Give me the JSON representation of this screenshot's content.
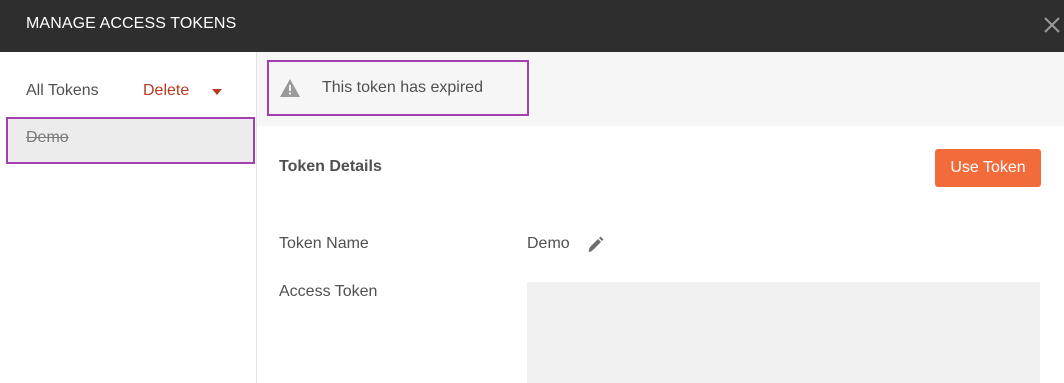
{
  "header": {
    "title": "MANAGE ACCESS TOKENS",
    "close_icon": "close-icon"
  },
  "sidebar": {
    "all_tokens_label": "All Tokens",
    "delete_label": "Delete",
    "dropdown_icon": "caret-down-icon",
    "tokens": [
      {
        "label": "Demo",
        "expired": true,
        "selected": true
      }
    ]
  },
  "detail": {
    "warning": {
      "icon": "warning-icon",
      "text": "This token has expired"
    },
    "section_title": "Token Details",
    "use_token_label": "Use Token",
    "fields": {
      "name_label": "Token Name",
      "name_value": "Demo",
      "edit_icon": "pencil-icon",
      "access_label": "Access Token",
      "access_value": ""
    }
  },
  "colors": {
    "header_bg": "#2e2e2e",
    "accent": "#f26b3a",
    "delete": "#b93a1f",
    "highlight": "#a43fb0"
  }
}
